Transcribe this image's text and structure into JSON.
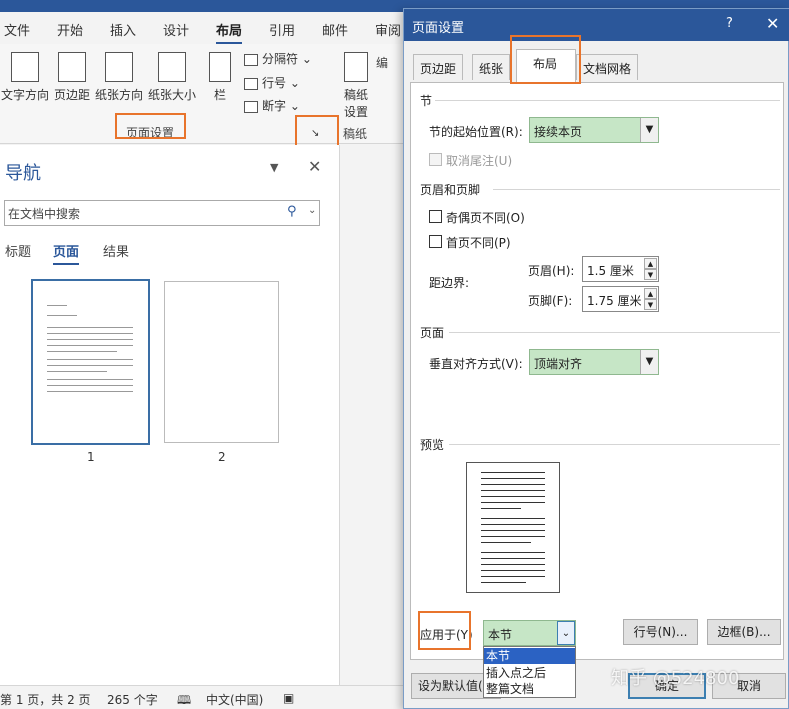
{
  "word": {
    "tabs": [
      "文件",
      "开始",
      "插入",
      "设计",
      "布局",
      "引用",
      "邮件",
      "审阅"
    ],
    "active_tab": "布局",
    "ribbon": {
      "text_direction": "文字方向",
      "margins": "页边距",
      "orientation": "纸张方向",
      "size": "纸张大小",
      "columns": "栏",
      "breaks": "分隔符",
      "line_numbers": "行号",
      "hyphenation": "断字",
      "draft_paper": "稿纸设置",
      "group_page_setup": "页面设置",
      "group_draft": "稿纸",
      "cut_label": "编"
    },
    "nav": {
      "title": "导航",
      "search_placeholder": "在文档中搜索",
      "tabs": [
        "标题",
        "页面",
        "结果"
      ],
      "active_tab": "页面",
      "pages": [
        "1",
        "2"
      ]
    },
    "status": {
      "page": "第 1 页，共 2 页",
      "words": "265 个字",
      "lang": "中文(中国)"
    }
  },
  "dialog": {
    "title": "页面设置",
    "help": "?",
    "close": "✕",
    "tabs": [
      "页边距",
      "纸张",
      "布局",
      "文档网格"
    ],
    "active_tab": "布局",
    "section": {
      "heading": "节",
      "start_label": "节的起始位置(R):",
      "start_value": "接续本页",
      "suppress_endnotes": "取消尾注(U)"
    },
    "header_footer": {
      "heading": "页眉和页脚",
      "odd_even": "奇偶页不同(O)",
      "first_page": "首页不同(P)",
      "from_edge": "距边界:",
      "header_label": "页眉(H):",
      "header_value": "1.5 厘米",
      "footer_label": "页脚(F):",
      "footer_value": "1.75 厘米"
    },
    "page": {
      "heading": "页面",
      "valign_label": "垂直对齐方式(V):",
      "valign_value": "顶端对齐"
    },
    "preview": {
      "heading": "预览"
    },
    "apply": {
      "label": "应用于(Y)",
      "value": "本节",
      "options": [
        "本节",
        "插入点之后",
        "整篇文档"
      ],
      "selected": "本节"
    },
    "buttons": {
      "line_numbers": "行号(N)...",
      "borders": "边框(B)...",
      "set_default": "设为默认值(D",
      "ok": "确定",
      "cancel": "取消"
    },
    "watermark": "知乎 @524800"
  },
  "colors": {
    "accent": "#2b579a",
    "highlight": "#e8742c",
    "combo_fill": "#c6e6c6"
  }
}
